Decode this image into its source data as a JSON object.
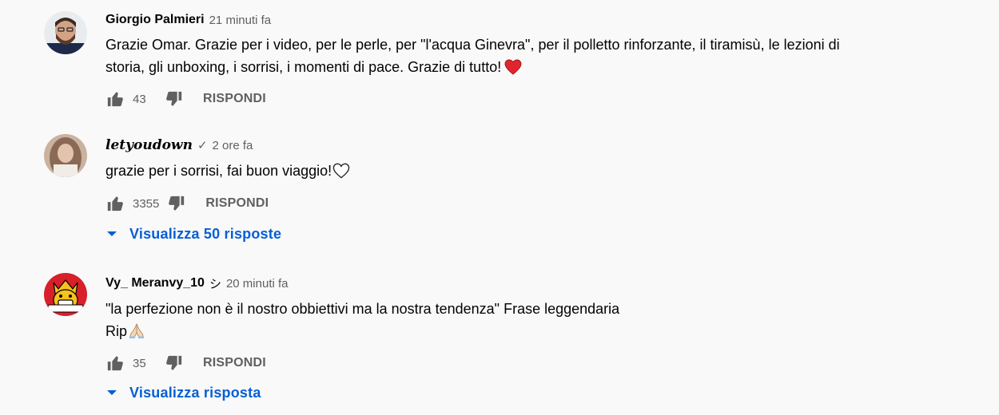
{
  "comments": [
    {
      "author": "Giorgio Palmieri",
      "time": "21 minuti fa",
      "text_line1": "Grazie Omar. Grazie per i video, per le perle, per \"l'acqua Ginevra\", per il polletto rinforzante, il tiramisù, le lezioni di",
      "text_line2": "storia, gli unboxing, i sorrisi, i momenti di pace. Grazie di tutto!",
      "likes": "43",
      "reply_label": "RISPONDI"
    },
    {
      "author": "letyoudown",
      "verified_mark": "✓",
      "time": "2 ore fa",
      "text_line1": "grazie per i sorrisi, fai buon viaggio!",
      "likes": "3355",
      "reply_label": "RISPONDI",
      "replies_label": "Visualizza 50 risposte"
    },
    {
      "author": "Vy_ Meranvy_10",
      "name_mark": "シ",
      "time": "20 minuti fa",
      "text_line1": "\"la perfezione non è il nostro obbiettivi ma la nostra tendenza\" Frase leggendaria",
      "text_line2": "Rip",
      "likes": "35",
      "reply_label": "RISPONDI",
      "replies_label": "Visualizza risposta"
    }
  ],
  "colors": {
    "background": "#f9f9f9",
    "text": "#030303",
    "secondary": "#606060",
    "link": "#065fd4",
    "heart": "#e0262d"
  }
}
